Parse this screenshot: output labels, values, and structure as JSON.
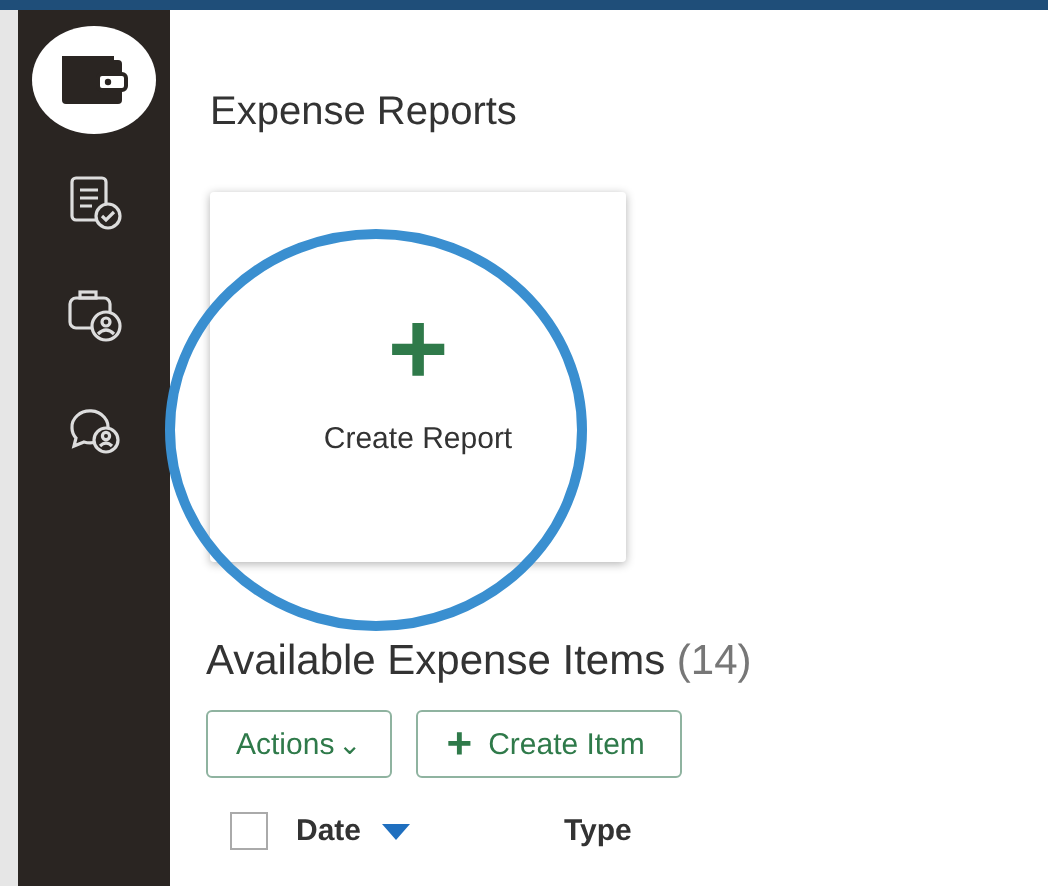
{
  "sidebar": {
    "items": [
      {
        "kind": "wallet",
        "selected": true
      },
      {
        "kind": "report",
        "selected": false
      },
      {
        "kind": "camera",
        "selected": false
      },
      {
        "kind": "chat",
        "selected": false
      }
    ]
  },
  "page_title": "Expense Reports",
  "create_card": {
    "icon": "+",
    "label": "Create Report"
  },
  "section": {
    "title": "Available Expense Items",
    "count": "(14)"
  },
  "toolbar": {
    "actions": {
      "label": "Actions",
      "caret": "⌄"
    },
    "create": {
      "icon": "+",
      "label": "Create Item"
    }
  },
  "table": {
    "select_all_checked": false,
    "columns": [
      {
        "label": "Date",
        "sorted": true
      },
      {
        "label": "Type",
        "sorted": false
      }
    ]
  }
}
